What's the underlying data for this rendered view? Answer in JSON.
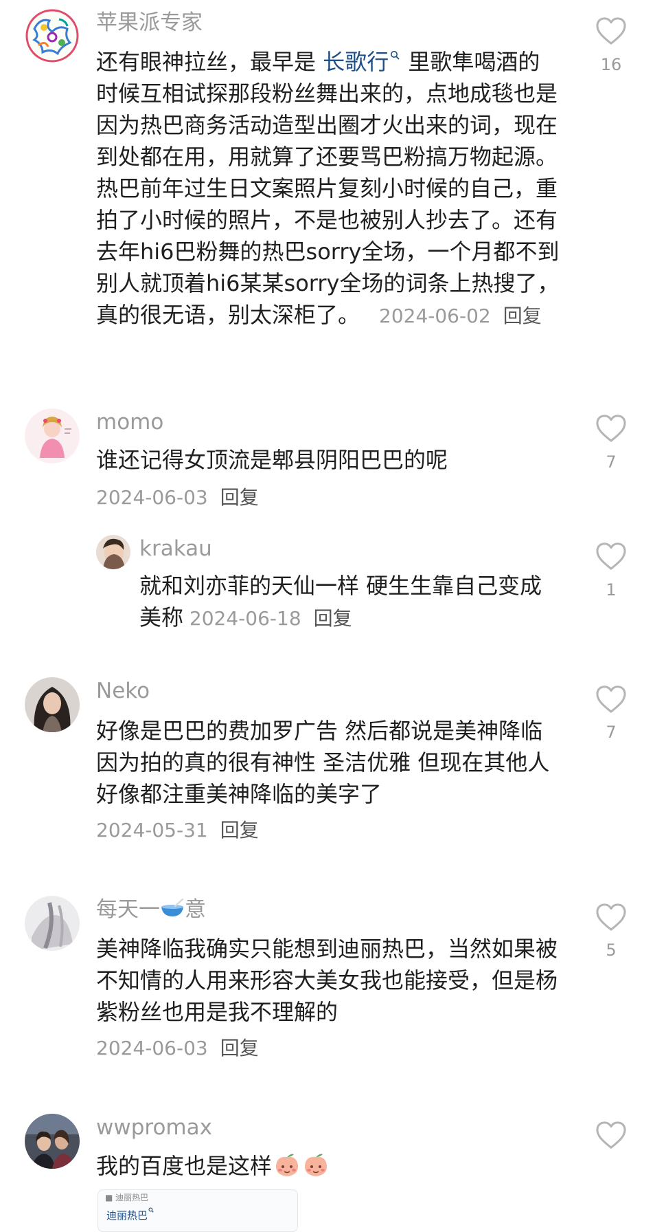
{
  "comments": [
    {
      "username": "苹果派专家",
      "text_before_link": "还有眼神拉丝，最早是 ",
      "link_text": "长歌行",
      "text_after_link": " 里歌隼喝酒的时候互相试探那段粉丝舞出来的，点地成毯也是因为热巴商务活动造型出圈才火出来的词，现在到处都在用，用就算了还要骂巴粉搞万物起源。热巴前年过生日文案照片复刻小时候的自己，重拍了小时候的照片，不是也被别人抄去了。还有去年hi6巴粉舞的热巴sorry全场，一个月都不到别人就顶着hi6某某sorry全场的词条上热搜了，真的很无语，别太深柜了。",
      "date": "2024-06-02",
      "reply": "回复",
      "likes": "16",
      "avatar_icon": "colorful-doodle-avatar-icon"
    },
    {
      "username": "momo",
      "text": "谁还记得女顶流是郫县阴阳巴巴的呢",
      "date": "2024-06-03",
      "reply": "回复",
      "likes": "7",
      "avatar_icon": "pink-illustration-avatar-icon"
    },
    {
      "username": "krakau",
      "text": "就和刘亦菲的天仙一样 硬生生靠自己变成美称",
      "date": "2024-06-18",
      "reply": "回复",
      "likes": "1",
      "avatar_icon": "photo-avatar-icon"
    },
    {
      "username": "Neko",
      "text": "好像是巴巴的费加罗广告 然后都说是美神降临 因为拍的真的很有神性 圣洁优雅 但现在其他人好像都注重美神降临的美字了",
      "date": "2024-05-31",
      "reply": "回复",
      "likes": "7",
      "avatar_icon": "dark-hair-avatar-icon"
    },
    {
      "username_before_emoji": "每天一",
      "username_after_emoji": "意",
      "emoji": "bowl-emoji-icon",
      "text": "美神降临我确实只能想到迪丽热巴，当然如果被不知情的人用来形容大美女我也能接受，但是杨紫粉丝也用是我不理解的",
      "date": "2024-06-03",
      "reply": "回复",
      "likes": "5",
      "avatar_icon": "grey-blur-avatar-icon"
    },
    {
      "username": "wwpromax",
      "text": "我的百度也是这样",
      "emojis": [
        "peach-emoji-icon",
        "peach-emoji-icon"
      ],
      "likes": "",
      "avatar_icon": "group-photo-avatar-icon"
    }
  ],
  "thumbnail": {
    "header_text": "■ 迪丽热巴",
    "tag_text": "迪丽热巴"
  },
  "colors": {
    "text": "#1f1f1f",
    "meta": "#9a9a9a",
    "link": "#1f4f86",
    "heart": "#bcbcbc"
  }
}
